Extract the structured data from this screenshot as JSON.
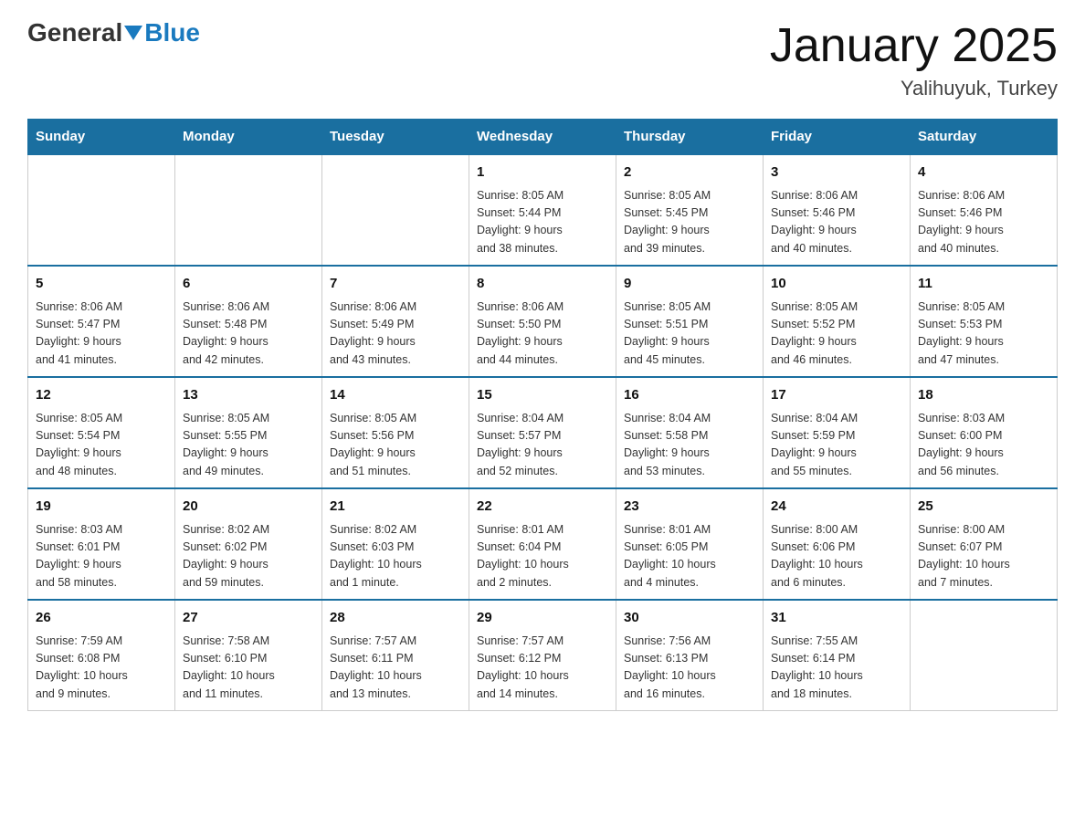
{
  "header": {
    "logo": {
      "general": "General",
      "blue": "Blue"
    },
    "title": "January 2025",
    "subtitle": "Yalihuyuk, Turkey"
  },
  "weekdays": [
    "Sunday",
    "Monday",
    "Tuesday",
    "Wednesday",
    "Thursday",
    "Friday",
    "Saturday"
  ],
  "weeks": [
    [
      {
        "day": "",
        "info": ""
      },
      {
        "day": "",
        "info": ""
      },
      {
        "day": "",
        "info": ""
      },
      {
        "day": "1",
        "info": "Sunrise: 8:05 AM\nSunset: 5:44 PM\nDaylight: 9 hours\nand 38 minutes."
      },
      {
        "day": "2",
        "info": "Sunrise: 8:05 AM\nSunset: 5:45 PM\nDaylight: 9 hours\nand 39 minutes."
      },
      {
        "day": "3",
        "info": "Sunrise: 8:06 AM\nSunset: 5:46 PM\nDaylight: 9 hours\nand 40 minutes."
      },
      {
        "day": "4",
        "info": "Sunrise: 8:06 AM\nSunset: 5:46 PM\nDaylight: 9 hours\nand 40 minutes."
      }
    ],
    [
      {
        "day": "5",
        "info": "Sunrise: 8:06 AM\nSunset: 5:47 PM\nDaylight: 9 hours\nand 41 minutes."
      },
      {
        "day": "6",
        "info": "Sunrise: 8:06 AM\nSunset: 5:48 PM\nDaylight: 9 hours\nand 42 minutes."
      },
      {
        "day": "7",
        "info": "Sunrise: 8:06 AM\nSunset: 5:49 PM\nDaylight: 9 hours\nand 43 minutes."
      },
      {
        "day": "8",
        "info": "Sunrise: 8:06 AM\nSunset: 5:50 PM\nDaylight: 9 hours\nand 44 minutes."
      },
      {
        "day": "9",
        "info": "Sunrise: 8:05 AM\nSunset: 5:51 PM\nDaylight: 9 hours\nand 45 minutes."
      },
      {
        "day": "10",
        "info": "Sunrise: 8:05 AM\nSunset: 5:52 PM\nDaylight: 9 hours\nand 46 minutes."
      },
      {
        "day": "11",
        "info": "Sunrise: 8:05 AM\nSunset: 5:53 PM\nDaylight: 9 hours\nand 47 minutes."
      }
    ],
    [
      {
        "day": "12",
        "info": "Sunrise: 8:05 AM\nSunset: 5:54 PM\nDaylight: 9 hours\nand 48 minutes."
      },
      {
        "day": "13",
        "info": "Sunrise: 8:05 AM\nSunset: 5:55 PM\nDaylight: 9 hours\nand 49 minutes."
      },
      {
        "day": "14",
        "info": "Sunrise: 8:05 AM\nSunset: 5:56 PM\nDaylight: 9 hours\nand 51 minutes."
      },
      {
        "day": "15",
        "info": "Sunrise: 8:04 AM\nSunset: 5:57 PM\nDaylight: 9 hours\nand 52 minutes."
      },
      {
        "day": "16",
        "info": "Sunrise: 8:04 AM\nSunset: 5:58 PM\nDaylight: 9 hours\nand 53 minutes."
      },
      {
        "day": "17",
        "info": "Sunrise: 8:04 AM\nSunset: 5:59 PM\nDaylight: 9 hours\nand 55 minutes."
      },
      {
        "day": "18",
        "info": "Sunrise: 8:03 AM\nSunset: 6:00 PM\nDaylight: 9 hours\nand 56 minutes."
      }
    ],
    [
      {
        "day": "19",
        "info": "Sunrise: 8:03 AM\nSunset: 6:01 PM\nDaylight: 9 hours\nand 58 minutes."
      },
      {
        "day": "20",
        "info": "Sunrise: 8:02 AM\nSunset: 6:02 PM\nDaylight: 9 hours\nand 59 minutes."
      },
      {
        "day": "21",
        "info": "Sunrise: 8:02 AM\nSunset: 6:03 PM\nDaylight: 10 hours\nand 1 minute."
      },
      {
        "day": "22",
        "info": "Sunrise: 8:01 AM\nSunset: 6:04 PM\nDaylight: 10 hours\nand 2 minutes."
      },
      {
        "day": "23",
        "info": "Sunrise: 8:01 AM\nSunset: 6:05 PM\nDaylight: 10 hours\nand 4 minutes."
      },
      {
        "day": "24",
        "info": "Sunrise: 8:00 AM\nSunset: 6:06 PM\nDaylight: 10 hours\nand 6 minutes."
      },
      {
        "day": "25",
        "info": "Sunrise: 8:00 AM\nSunset: 6:07 PM\nDaylight: 10 hours\nand 7 minutes."
      }
    ],
    [
      {
        "day": "26",
        "info": "Sunrise: 7:59 AM\nSunset: 6:08 PM\nDaylight: 10 hours\nand 9 minutes."
      },
      {
        "day": "27",
        "info": "Sunrise: 7:58 AM\nSunset: 6:10 PM\nDaylight: 10 hours\nand 11 minutes."
      },
      {
        "day": "28",
        "info": "Sunrise: 7:57 AM\nSunset: 6:11 PM\nDaylight: 10 hours\nand 13 minutes."
      },
      {
        "day": "29",
        "info": "Sunrise: 7:57 AM\nSunset: 6:12 PM\nDaylight: 10 hours\nand 14 minutes."
      },
      {
        "day": "30",
        "info": "Sunrise: 7:56 AM\nSunset: 6:13 PM\nDaylight: 10 hours\nand 16 minutes."
      },
      {
        "day": "31",
        "info": "Sunrise: 7:55 AM\nSunset: 6:14 PM\nDaylight: 10 hours\nand 18 minutes."
      },
      {
        "day": "",
        "info": ""
      }
    ]
  ]
}
